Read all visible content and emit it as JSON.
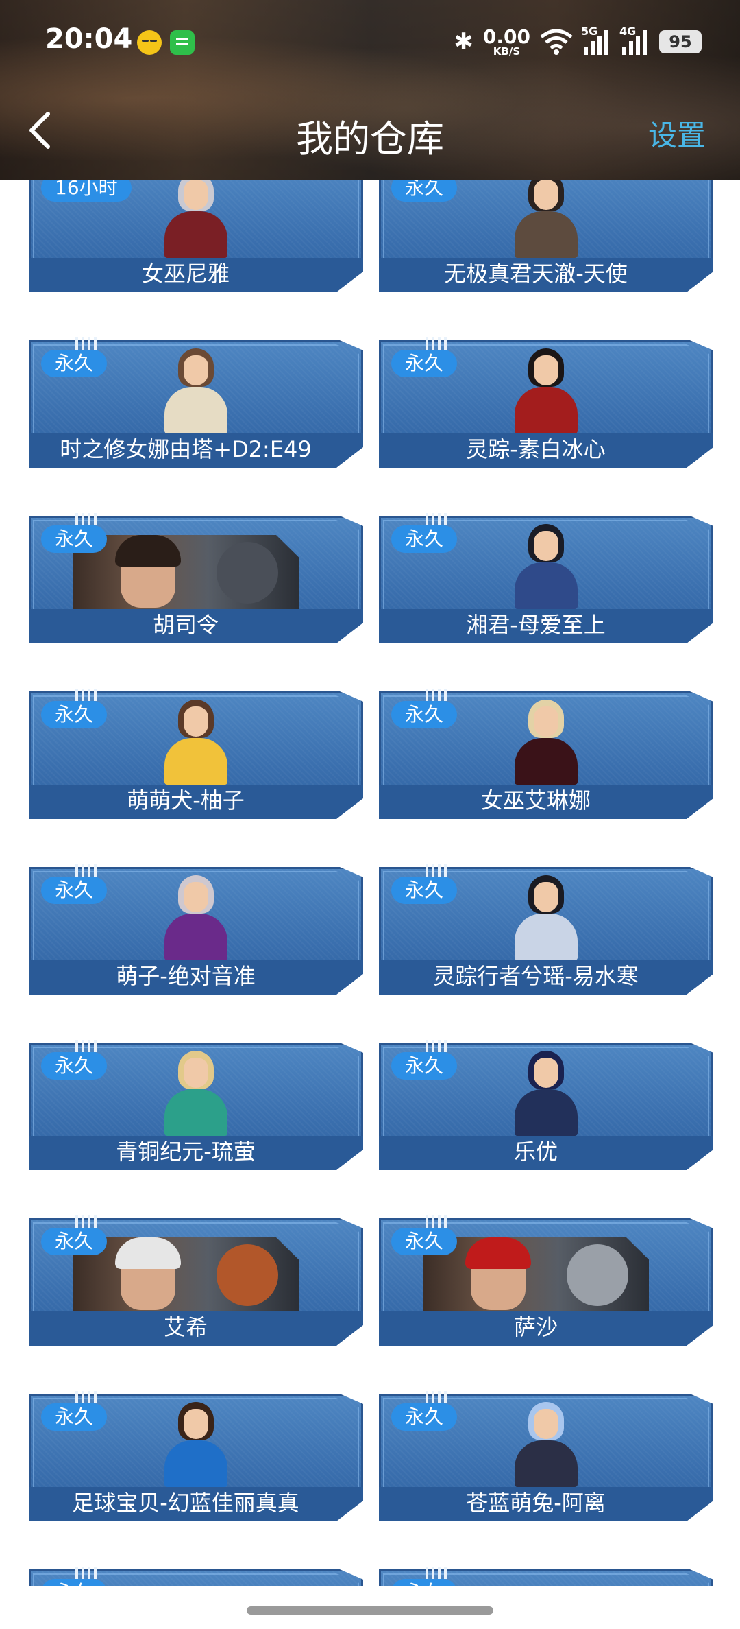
{
  "status_bar": {
    "time": "20:04",
    "net_speed_value": "0.00",
    "net_speed_unit": "KB/S",
    "signal1_label": "5G",
    "signal2_label": "4G",
    "battery": "95",
    "bluetooth_glyph": "✱"
  },
  "header": {
    "title": "我的仓库",
    "settings_label": "设置"
  },
  "items": [
    {
      "badge": "16小时",
      "name": "女巫尼雅",
      "display": "portrait",
      "hair": "#c9c9d2",
      "outfit": "#7a1f25"
    },
    {
      "badge": "永久",
      "name": "无极真君天澈-天使",
      "display": "portrait",
      "hair": "#2a2220",
      "outfit": "#5d4b3e"
    },
    {
      "badge": "永久",
      "name": "时之修女娜由塔+D2:E49",
      "display": "portrait",
      "hair": "#6b4a35",
      "outfit": "#e6dcc4"
    },
    {
      "badge": "永久",
      "name": "灵踪-素白冰心",
      "display": "portrait",
      "hair": "#1b1616",
      "outfit": "#a31d1d"
    },
    {
      "badge": "永久",
      "name": "胡司令",
      "display": "banner",
      "hair": "#2a1e18",
      "outfit": "#4a4f58"
    },
    {
      "badge": "永久",
      "name": "湘君-母爱至上",
      "display": "portrait",
      "hair": "#1a1c26",
      "outfit": "#2f4a8a"
    },
    {
      "badge": "永久",
      "name": "萌萌犬-柚子",
      "display": "portrait",
      "hair": "#5b3a28",
      "outfit": "#f1c23a"
    },
    {
      "badge": "永久",
      "name": "女巫艾琳娜",
      "display": "portrait",
      "hair": "#e3d2a6",
      "outfit": "#3a1218"
    },
    {
      "badge": "永久",
      "name": "萌子-绝对音准",
      "display": "portrait",
      "hair": "#cfc8cf",
      "outfit": "#6a2a8a"
    },
    {
      "badge": "永久",
      "name": "灵踪行者兮瑶-易水寒",
      "display": "portrait",
      "hair": "#1b1b22",
      "outfit": "#c9d4e6"
    },
    {
      "badge": "永久",
      "name": "青铜纪元-琉萤",
      "display": "portrait",
      "hair": "#e2c98a",
      "outfit": "#2ca08a"
    },
    {
      "badge": "永久",
      "name": "乐优",
      "display": "portrait",
      "hair": "#1a2250",
      "outfit": "#22305a"
    },
    {
      "badge": "永久",
      "name": "艾希",
      "display": "banner",
      "hair": "#e6e6e6",
      "outfit": "#b2572a"
    },
    {
      "badge": "永久",
      "name": "萨沙",
      "display": "banner",
      "hair": "#c01b1b",
      "outfit": "#9aa0a8"
    },
    {
      "badge": "永久",
      "name": "足球宝贝-幻蓝佳丽真真",
      "display": "portrait",
      "hair": "#3a2418",
      "outfit": "#1f6fc8"
    },
    {
      "badge": "永久",
      "name": "苍蓝萌兔-阿离",
      "display": "portrait",
      "hair": "#a9c6ee",
      "outfit": "#2b2f46"
    },
    {
      "badge": "永久",
      "name": "",
      "display": "banner",
      "hair": "#3a4d6a",
      "outfit": "#5a6270"
    },
    {
      "badge": "永久",
      "name": "",
      "display": "banner",
      "hair": "#6b2020",
      "outfit": "#4a3030"
    }
  ]
}
